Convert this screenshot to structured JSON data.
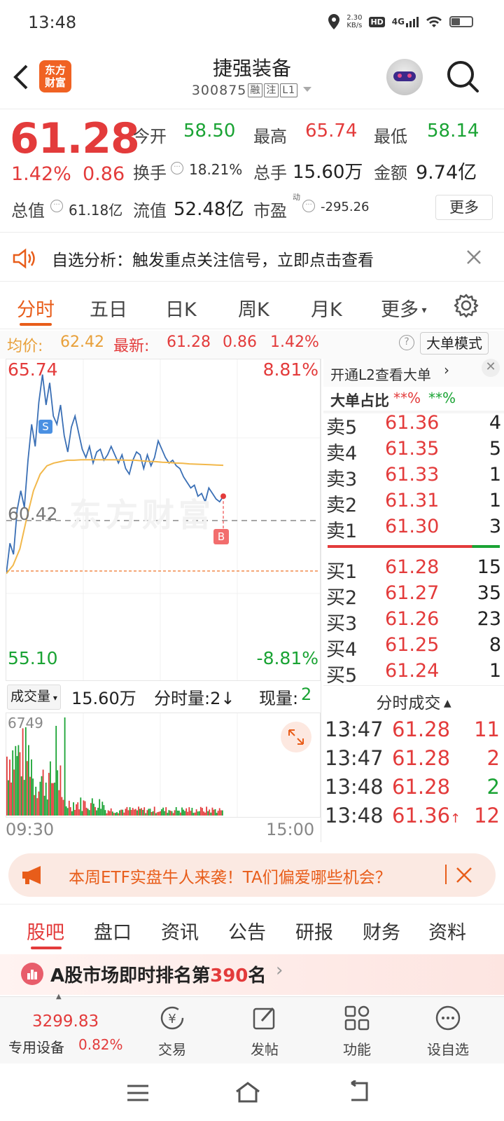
{
  "status_bar": {
    "time": "13:48",
    "speed": "2.30",
    "speed_unit": "KB/s",
    "network": "4G",
    "hd": "HD"
  },
  "header": {
    "logo_line1": "东方",
    "logo_line2": "财富",
    "title": "捷强装备",
    "code": "300875",
    "tags": [
      "融",
      "注",
      "L1"
    ]
  },
  "quote": {
    "price": "61.28",
    "change_pct": "1.42%",
    "change": "0.86",
    "open_label": "今开",
    "open": "58.50",
    "high_label": "最高",
    "high": "65.74",
    "low_label": "最低",
    "low": "58.14",
    "turnover_label": "换手",
    "turnover": "18.21%",
    "volume_label": "总手",
    "volume": "15.60万",
    "amount_label": "金额",
    "amount": "9.74亿",
    "mktcap_label": "总值",
    "mktcap": "61.18亿",
    "float_label": "流值",
    "float_cap": "52.48亿",
    "pe_label": "市盈",
    "pe_sup": "动",
    "pe": "-295.26",
    "more_label": "更多"
  },
  "notice": {
    "text": "自选分析：触发重点关注信号，立即点击查看"
  },
  "chart_tabs": [
    "分时",
    "五日",
    "日K",
    "周K",
    "月K",
    "更多"
  ],
  "infobar": {
    "avg_label": "均价:",
    "avg": "62.42",
    "latest_label": "最新:",
    "latest": "61.28",
    "change": "0.86",
    "pct": "1.42%",
    "mode_label": "大单模式"
  },
  "chart_labels": {
    "top_price": "65.74",
    "top_pct": "8.81%",
    "mid_price": "60.42",
    "bottom_price": "55.10",
    "bottom_pct": "-8.81%",
    "watermark": "东方财富",
    "marker_s": "S",
    "marker_b": "B"
  },
  "chart_data": {
    "type": "line",
    "x_range": [
      "09:30",
      "15:00"
    ],
    "ylim": [
      55.1,
      65.74
    ],
    "prev_close": 60.42,
    "series": [
      {
        "name": "最新",
        "values": [
          58.5,
          59.6,
          59.2,
          60.8,
          61.5,
          60.9,
          62.6,
          63.9,
          63.1,
          64.7,
          65.7,
          64.6,
          65.4,
          64.2,
          63.9,
          64.6,
          63.5,
          62.9,
          63.8,
          64.2,
          63.6,
          63.0,
          62.7,
          63.1,
          62.5,
          62.9,
          63.0,
          62.6,
          62.8,
          63.1,
          62.8,
          62.5,
          62.8,
          62.3,
          62.1,
          62.6,
          62.9,
          62.8,
          62.3,
          62.8,
          62.4,
          62.7,
          63.3,
          63.0,
          62.7,
          62.5,
          62.6,
          62.4,
          62.3,
          62.0,
          61.8,
          61.6,
          61.7,
          61.3,
          61.4,
          61.1,
          61.6,
          61.4,
          61.2,
          61.1,
          61.3
        ]
      },
      {
        "name": "均价",
        "values": [
          58.5,
          58.8,
          59.4,
          60.5,
          61.5,
          62.1,
          62.4,
          62.5,
          62.55,
          62.6,
          62.6,
          62.62,
          62.62,
          62.62,
          62.62,
          62.62,
          62.62,
          62.61,
          62.6,
          62.6,
          62.58,
          62.56,
          62.55,
          62.53,
          62.52,
          62.5,
          62.49,
          62.47,
          62.46,
          62.45,
          62.44,
          62.43,
          62.42
        ]
      }
    ]
  },
  "order_book": {
    "l2_label": "开通L2查看大单",
    "ratio_label": "大单占比",
    "ratio_buy": "**%",
    "ratio_sell": "**%",
    "asks": [
      {
        "name": "卖5",
        "price": "61.36",
        "qty": "4"
      },
      {
        "name": "卖4",
        "price": "61.35",
        "qty": "5"
      },
      {
        "name": "卖3",
        "price": "61.33",
        "qty": "1"
      },
      {
        "name": "卖2",
        "price": "61.31",
        "qty": "1"
      },
      {
        "name": "卖1",
        "price": "61.30",
        "qty": "3"
      }
    ],
    "bids": [
      {
        "name": "买1",
        "price": "61.28",
        "qty": "15"
      },
      {
        "name": "买2",
        "price": "61.27",
        "qty": "35"
      },
      {
        "name": "买3",
        "price": "61.26",
        "qty": "23"
      },
      {
        "name": "买4",
        "price": "61.25",
        "qty": "8"
      },
      {
        "name": "买5",
        "price": "61.24",
        "qty": "1"
      }
    ],
    "ticks_label": "分时成交",
    "ticks": [
      {
        "time": "13:47",
        "price": "61.28",
        "qty": "11",
        "dir": "red"
      },
      {
        "time": "13:47",
        "price": "61.28",
        "qty": "2",
        "dir": "red"
      },
      {
        "time": "13:48",
        "price": "61.28",
        "qty": "2",
        "dir": "green"
      },
      {
        "time": "13:48",
        "price": "61.36",
        "qty": "12",
        "dir": "red",
        "arrow": "↑"
      }
    ]
  },
  "volume": {
    "select_label": "成交量",
    "total": "15.60万",
    "per_label": "分时量:2↓",
    "now_label": "现量:",
    "now": "2",
    "max": "6749",
    "t_start": "09:30",
    "t_end": "15:00"
  },
  "banner": {
    "text": "本周ETF实盘牛人来袭！TA们偏爱哪些机会？"
  },
  "bottom_tabs": [
    "股吧",
    "盘口",
    "资讯",
    "公告",
    "研报",
    "财务",
    "资料"
  ],
  "rank": {
    "prefix": "A股市场即时排名第",
    "num": "390",
    "suffix": "名"
  },
  "nav": {
    "index_value": "3299.83",
    "index_name": "专用设备",
    "index_pct": "0.82%",
    "items": [
      "交易",
      "发帖",
      "功能",
      "设自选"
    ]
  },
  "colors": {
    "up": "#e33b3b",
    "down": "#1aa334",
    "accent": "#e85d1a",
    "price_line": "#3a6fb5",
    "avg_line": "#f2b84b"
  }
}
